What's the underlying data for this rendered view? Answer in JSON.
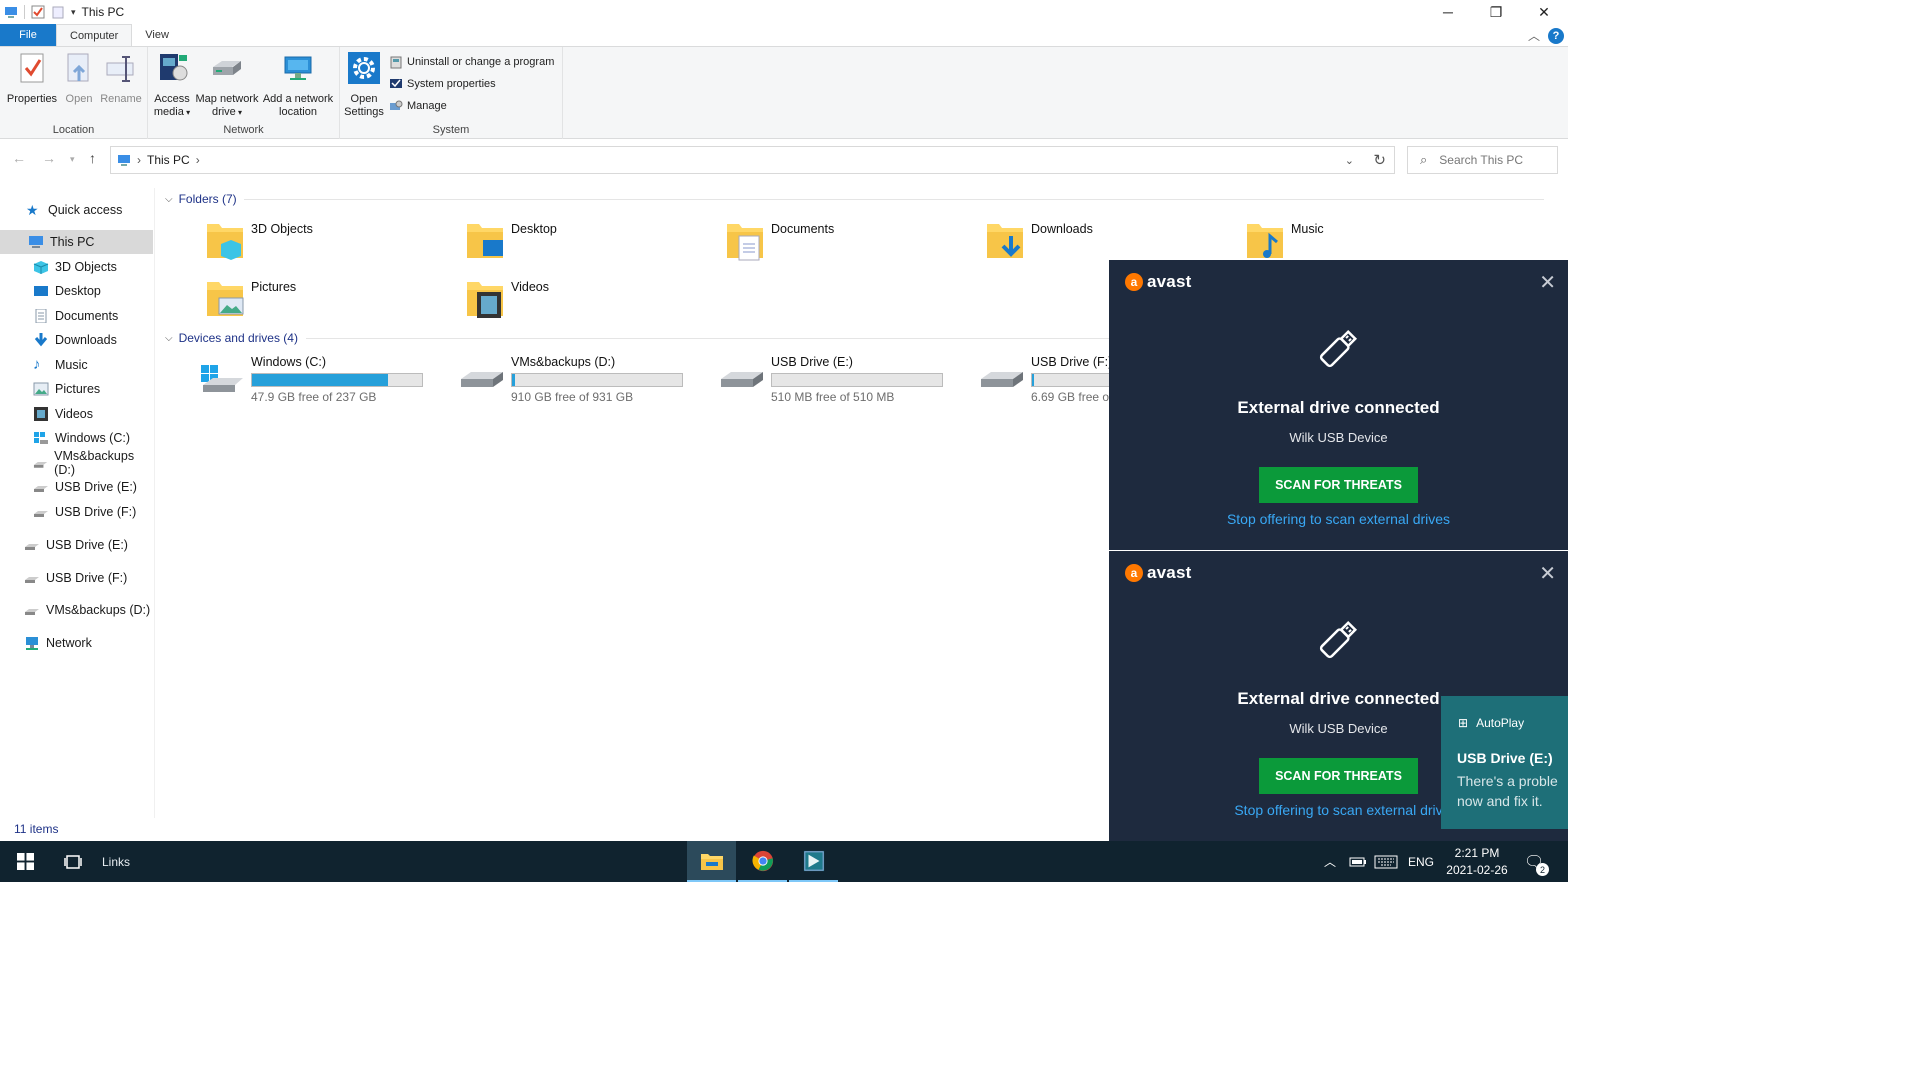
{
  "window": {
    "title": "This PC",
    "controls": {
      "minimize": "─",
      "restore": "❐",
      "close": "✕"
    }
  },
  "ribbon_tabs": [
    "File",
    "Computer",
    "View"
  ],
  "ribbon": {
    "location": {
      "label": "Location",
      "properties": "Properties",
      "open": "Open",
      "rename": "Rename"
    },
    "network": {
      "label": "Network",
      "access_media_1": "Access",
      "access_media_2": "media",
      "map_drive_1": "Map network",
      "map_drive_2": "drive",
      "add_location_1": "Add a network",
      "add_location_2": "location"
    },
    "system": {
      "label": "System",
      "open_settings_1": "Open",
      "open_settings_2": "Settings",
      "uninstall": "Uninstall or change a program",
      "system_properties": "System properties",
      "manage": "Manage"
    }
  },
  "address": {
    "path": "This PC",
    "search_placeholder": "Search This PC"
  },
  "sidebar": {
    "items": [
      {
        "label": "Quick access",
        "icon": "star-icon"
      },
      {
        "label": "This PC",
        "icon": "pc-icon",
        "selected": true
      },
      {
        "label": "3D Objects",
        "icon": "cube-icon"
      },
      {
        "label": "Desktop",
        "icon": "desktop-icon"
      },
      {
        "label": "Documents",
        "icon": "document-icon"
      },
      {
        "label": "Downloads",
        "icon": "download-icon"
      },
      {
        "label": "Music",
        "icon": "music-icon"
      },
      {
        "label": "Pictures",
        "icon": "picture-icon"
      },
      {
        "label": "Videos",
        "icon": "video-icon"
      },
      {
        "label": "Windows (C:)",
        "icon": "windows-drive-icon"
      },
      {
        "label": "VMs&backups (D:)",
        "icon": "drive-icon"
      },
      {
        "label": "USB Drive (E:)",
        "icon": "drive-icon"
      },
      {
        "label": "USB Drive (F:)",
        "icon": "drive-icon"
      },
      {
        "label": "USB Drive (E:)",
        "icon": "drive-icon"
      },
      {
        "label": "USB Drive (F:)",
        "icon": "drive-icon"
      },
      {
        "label": "VMs&backups (D:)",
        "icon": "drive-icon"
      },
      {
        "label": "Network",
        "icon": "network-icon"
      }
    ]
  },
  "folders": {
    "header": "Folders (7)",
    "items": [
      "3D Objects",
      "Desktop",
      "Documents",
      "Downloads",
      "Music",
      "Pictures",
      "Videos"
    ]
  },
  "drives": {
    "header": "Devices and drives (4)",
    "items": [
      {
        "name": "Windows (C:)",
        "free": "47.9 GB free of 237 GB",
        "used_fraction": 0.8
      },
      {
        "name": "VMs&backups (D:)",
        "free": "910 GB free of 931 GB",
        "used_fraction": 0.02
      },
      {
        "name": "USB Drive (E:)",
        "free": "510 MB free of 510 MB",
        "used_fraction": 0.0
      },
      {
        "name": "USB Drive (F:)",
        "free": "6.69 GB free of",
        "used_fraction": 0.01
      }
    ]
  },
  "status": {
    "items_count": "11 items"
  },
  "avast": [
    {
      "brand": "avast",
      "heading": "External drive connected",
      "device": "Wilk USB Device",
      "scan_button": "SCAN FOR THREATS",
      "stop_link": "Stop offering to scan external drives"
    },
    {
      "brand": "avast",
      "heading": "External drive connected",
      "device": "Wilk USB Device",
      "scan_button": "SCAN FOR THREATS",
      "stop_link": "Stop offering to scan external driv"
    }
  ],
  "autoplay": {
    "title": "AutoPlay",
    "drive": "USB Drive (E:)",
    "line1": "There's a proble",
    "line2": "now and fix it."
  },
  "taskbar": {
    "links_label": "Links",
    "language": "ENG",
    "time": "2:21 PM",
    "date": "2021-02-26",
    "notification_count": "2"
  },
  "colors": {
    "accent": "#1979ca",
    "drive_fill": "#26a0da",
    "avast_bg": "#1e2a3e",
    "avast_button": "#0b9a3a",
    "avast_link": "#39a8f4",
    "autoplay_bg": "#1e6f78",
    "taskbar_bg": "#10232f"
  }
}
